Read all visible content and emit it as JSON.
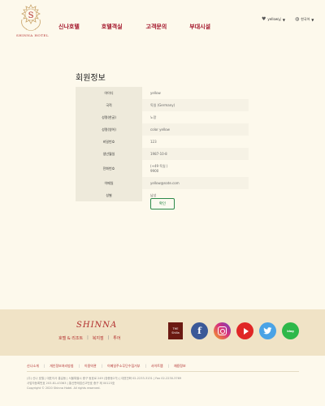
{
  "header": {
    "logo_text": "SHINNA HOTEL",
    "nav": [
      "신나호텔",
      "호텔객실",
      "고객문의",
      "부대시설"
    ],
    "user_label": "yellow님",
    "lang_label": "한국어"
  },
  "main": {
    "title": "회원정보",
    "rows": [
      {
        "label": "아이디",
        "value": "yellow"
      },
      {
        "label": "국적",
        "value": "독일 (Germany)"
      },
      {
        "label": "성명(한글)",
        "value": "노랑"
      },
      {
        "label": "성명(영어)",
        "value": "color yellow"
      },
      {
        "label": "비밀번호",
        "value": "123"
      },
      {
        "label": "생년월일",
        "value": "1987-10-8"
      },
      {
        "label": "전화번호",
        "value": "(+49 독일 )",
        "value2": "9900"
      },
      {
        "label": "이메일",
        "value": "yellow@nate.com"
      },
      {
        "label": "성별",
        "value": "남성"
      }
    ],
    "confirm_label": "확인"
  },
  "footer": {
    "brand": "SHINNA",
    "brand_links": [
      "호텔 & 리조트",
      "복지점",
      "투어"
    ],
    "social": {
      "thesh_line1": "THE",
      "thesh_line2": "Shilla",
      "facebook_glyph": "f",
      "blog_label": "blog"
    },
    "policy_links": [
      "신나소개",
      "개인정보처리방침",
      "이용약관",
      "이메일주소무단수집거부",
      "사이트맵",
      "채용정보"
    ],
    "address_lines": [
      "(주) 신나 호텔 | 대표이사 홍길동 | 서울특별시 중구 동호로 249 (장충동2가) | 대표전화 02-2233-3131 | Fax 02-2230-3769",
      "사업자등록번호 203-81-43363 | 통신판매업신고번호 중구 제 00123호",
      "Copyright © 2020 Shinna Hotel. All rights reserved."
    ]
  }
}
